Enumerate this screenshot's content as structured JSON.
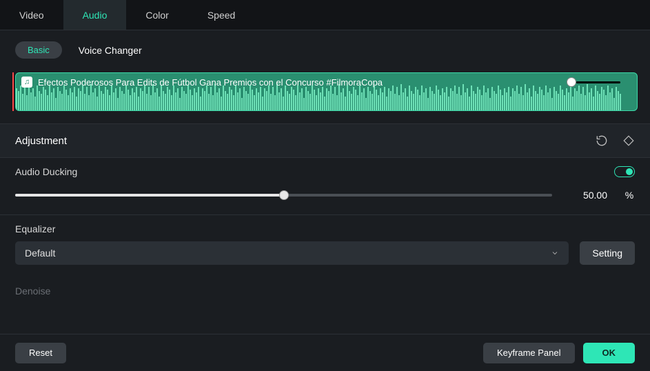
{
  "tabs": {
    "video": "Video",
    "audio": "Audio",
    "color": "Color",
    "speed": "Speed"
  },
  "subTabs": {
    "basic": "Basic",
    "voiceChanger": "Voice Changer"
  },
  "clip": {
    "title": "Efectos Poderosos Para Edits de Fútbol   Gana Premios con el Concurso #FilmoraCopa"
  },
  "sections": {
    "adjustment": "Adjustment"
  },
  "ducking": {
    "label": "Audio Ducking",
    "value": "50.00",
    "unit": "%"
  },
  "equalizer": {
    "label": "Equalizer",
    "selected": "Default",
    "settingBtn": "Setting"
  },
  "denoise": {
    "label": "Denoise"
  },
  "footer": {
    "reset": "Reset",
    "keyframe": "Keyframe Panel",
    "ok": "OK"
  }
}
